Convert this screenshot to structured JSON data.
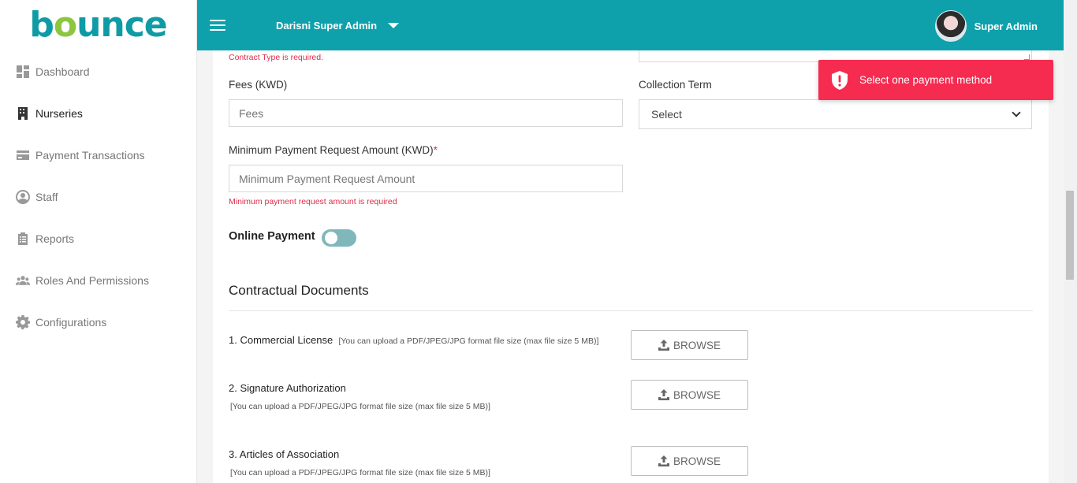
{
  "brand": {
    "logo_text_b": "b",
    "logo_text_o": "o",
    "logo_text_rest": "unce"
  },
  "sidebar": {
    "items": [
      {
        "label": "Dashboard",
        "icon": "dashboard-icon"
      },
      {
        "label": "Nurseries",
        "icon": "building-icon"
      },
      {
        "label": "Payment Transactions",
        "icon": "credit-card-icon"
      },
      {
        "label": "Staff",
        "icon": "user-circle-icon"
      },
      {
        "label": "Reports",
        "icon": "clipboard-icon"
      },
      {
        "label": "Roles And Permissions",
        "icon": "users-icon"
      },
      {
        "label": "Configurations",
        "icon": "gear-icon"
      }
    ]
  },
  "header": {
    "admin_select": "Darisni Super Admin",
    "user_name": "Super Admin"
  },
  "form": {
    "contract_type_error": "Contract Type is required.",
    "fees_label": "Fees (KWD)",
    "fees_placeholder": "Fees",
    "collection_term_label": "Collection Term",
    "collection_term_value": "Select",
    "min_payment_label": "Minimum Payment Request Amount (KWD)",
    "min_payment_required_mark": "*",
    "min_payment_placeholder": "Minimum Payment Request Amount",
    "min_payment_error": "Minimum payment request amount is required",
    "online_payment_label": "Online Payment",
    "online_payment_enabled": false
  },
  "documents": {
    "title": "Contractual Documents",
    "browse_label": "BROWSE",
    "items": [
      {
        "label": "1. Commercial License",
        "hint": "[You can upload a PDF/JPEG/JPG format file size (max file size 5 MB)]"
      },
      {
        "label": "2. Signature Authorization",
        "hint": "[You can upload a PDF/JPEG/JPG format file size (max file size 5 MB)]"
      },
      {
        "label": "3. Articles of Association",
        "hint": "[You can upload a PDF/JPEG/JPG format file size (max file size 5 MB)]"
      }
    ]
  },
  "toast": {
    "message": "Select one payment method",
    "icon": "shield-alert-icon",
    "color": "#f52b50"
  },
  "colors": {
    "header": "#0ea1ab",
    "brand_teal": "#0e9ba5",
    "brand_green": "#8cc63f",
    "error": "#e02c4a"
  }
}
